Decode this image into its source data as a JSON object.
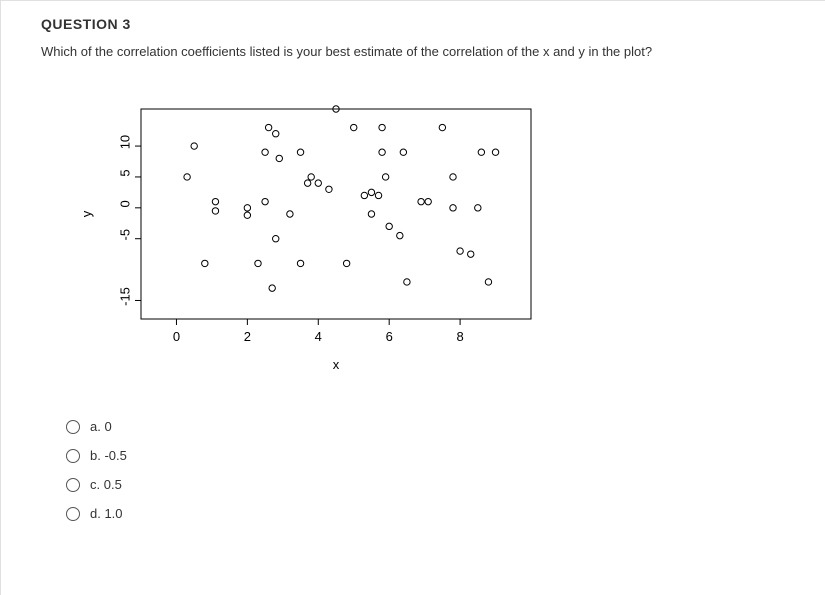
{
  "question": {
    "title": "QUESTION 3",
    "text": "Which of the correlation coefficients listed is your best estimate of the correlation of the x and y in the plot?"
  },
  "chart_data": {
    "type": "scatter",
    "xlabel": "x",
    "ylabel": "y",
    "xlim": [
      -1,
      10
    ],
    "ylim": [
      -18,
      16
    ],
    "x_ticks": [
      0,
      2,
      4,
      6,
      8
    ],
    "y_ticks": [
      -15,
      -5,
      0,
      5,
      10
    ],
    "points": [
      {
        "x": 0.5,
        "y": 10
      },
      {
        "x": 0.3,
        "y": 5
      },
      {
        "x": 1.1,
        "y": 1
      },
      {
        "x": 1.1,
        "y": -0.5
      },
      {
        "x": 0.8,
        "y": -9
      },
      {
        "x": 2.0,
        "y": 0
      },
      {
        "x": 2.0,
        "y": -1.2
      },
      {
        "x": 2.6,
        "y": 13
      },
      {
        "x": 2.8,
        "y": 12
      },
      {
        "x": 2.5,
        "y": 9
      },
      {
        "x": 2.5,
        "y": 1
      },
      {
        "x": 2.9,
        "y": 8
      },
      {
        "x": 2.8,
        "y": -5
      },
      {
        "x": 2.3,
        "y": -9
      },
      {
        "x": 2.7,
        "y": -13
      },
      {
        "x": 3.2,
        "y": -1
      },
      {
        "x": 3.5,
        "y": 9
      },
      {
        "x": 3.8,
        "y": 5
      },
      {
        "x": 3.7,
        "y": 4
      },
      {
        "x": 3.5,
        "y": -9
      },
      {
        "x": 4.0,
        "y": 4
      },
      {
        "x": 4.3,
        "y": 3
      },
      {
        "x": 4.5,
        "y": 16
      },
      {
        "x": 4.8,
        "y": -9
      },
      {
        "x": 5.0,
        "y": 13
      },
      {
        "x": 5.3,
        "y": 2
      },
      {
        "x": 5.5,
        "y": 2.5
      },
      {
        "x": 5.5,
        "y": -1
      },
      {
        "x": 5.7,
        "y": 2
      },
      {
        "x": 5.8,
        "y": 13
      },
      {
        "x": 5.8,
        "y": 9
      },
      {
        "x": 5.9,
        "y": 5
      },
      {
        "x": 6.0,
        "y": -3
      },
      {
        "x": 6.3,
        "y": -4.5
      },
      {
        "x": 6.4,
        "y": 9
      },
      {
        "x": 6.5,
        "y": -12
      },
      {
        "x": 6.9,
        "y": 1
      },
      {
        "x": 7.1,
        "y": 1
      },
      {
        "x": 7.5,
        "y": 13
      },
      {
        "x": 7.8,
        "y": 5
      },
      {
        "x": 7.8,
        "y": 0
      },
      {
        "x": 8.0,
        "y": -7
      },
      {
        "x": 8.3,
        "y": -7.5
      },
      {
        "x": 8.5,
        "y": 0
      },
      {
        "x": 8.6,
        "y": 9
      },
      {
        "x": 8.8,
        "y": -12
      },
      {
        "x": 9.0,
        "y": 9
      }
    ]
  },
  "options": {
    "a": "a. 0",
    "b": "b. -0.5",
    "c": "c. 0.5",
    "d": "d. 1.0"
  }
}
